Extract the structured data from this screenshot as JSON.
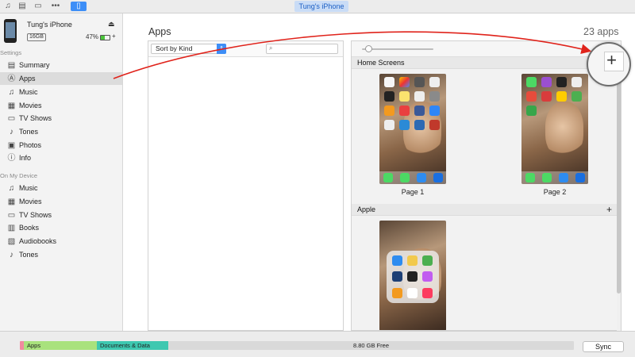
{
  "toolbar": {
    "device_pill": "Tung's iPhone",
    "icons": [
      "music-note-icon",
      "film-icon",
      "tv-icon",
      "more-icon",
      "iphone-icon"
    ]
  },
  "device": {
    "name": "Tung's iPhone",
    "capacity": "16GB",
    "battery": "47%",
    "battery_level": 0.47,
    "charge_symbol": "+"
  },
  "sidebar": {
    "settings_label": "Settings",
    "settings_items": [
      {
        "label": "Summary",
        "icon": "summary-icon"
      },
      {
        "label": "Apps",
        "icon": "apps-icon",
        "selected": true
      },
      {
        "label": "Music",
        "icon": "music-icon"
      },
      {
        "label": "Movies",
        "icon": "movies-icon"
      },
      {
        "label": "TV Shows",
        "icon": "tv-shows-icon"
      },
      {
        "label": "Tones",
        "icon": "tones-icon"
      },
      {
        "label": "Photos",
        "icon": "photos-icon"
      },
      {
        "label": "Info",
        "icon": "info-icon"
      }
    ],
    "device_label": "On My Device",
    "device_items": [
      {
        "label": "Music",
        "icon": "music-icon"
      },
      {
        "label": "Movies",
        "icon": "movies-icon"
      },
      {
        "label": "TV Shows",
        "icon": "tv-shows-icon"
      },
      {
        "label": "Books",
        "icon": "books-icon"
      },
      {
        "label": "Audiobooks",
        "icon": "audiobooks-icon"
      },
      {
        "label": "Tones",
        "icon": "tones-icon"
      }
    ]
  },
  "main": {
    "title": "Apps",
    "count": "23 apps",
    "sort_label": "Sort by Kind",
    "search_placeholder": ""
  },
  "home_screens": {
    "header": "Home Screens",
    "pages": [
      "Page 1",
      "Page 2"
    ],
    "apple_header": "Apple",
    "add_symbol": "+"
  },
  "storage": {
    "apps_label": "Apps",
    "docs_label": "Documents & Data",
    "free_label": "8.80 GB Free"
  },
  "sync_label": "Sync",
  "colors": {
    "accent": "#3d8ef7",
    "annotation": "#e0231b"
  }
}
